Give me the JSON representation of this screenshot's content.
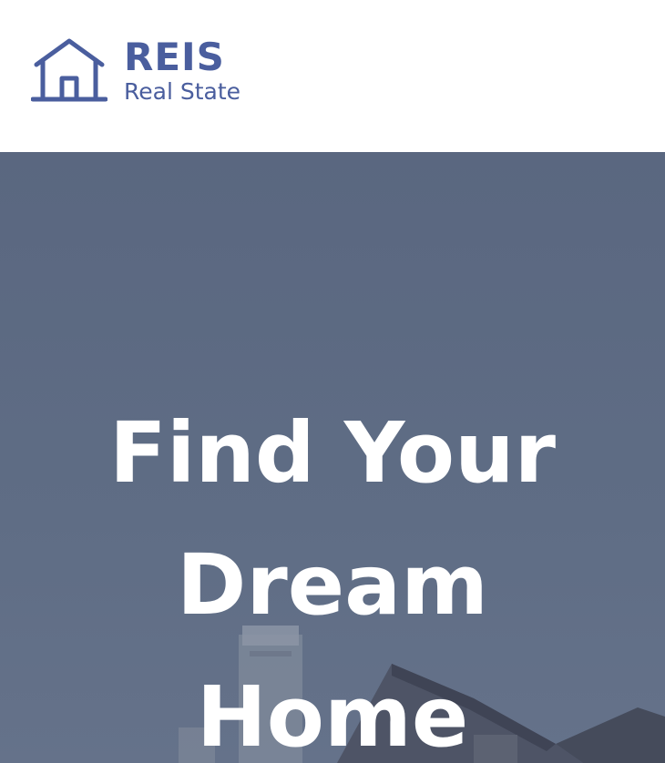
{
  "header": {
    "brand_name": "REIS",
    "brand_tagline": "Real State",
    "logo_icon": "house-icon",
    "accent_color": "#4a5e9e"
  },
  "hero": {
    "title_lines": [
      "Find Your",
      "Dream",
      "Home"
    ],
    "overlay_color": "#5c6a82",
    "text_color": "#ffffff"
  }
}
